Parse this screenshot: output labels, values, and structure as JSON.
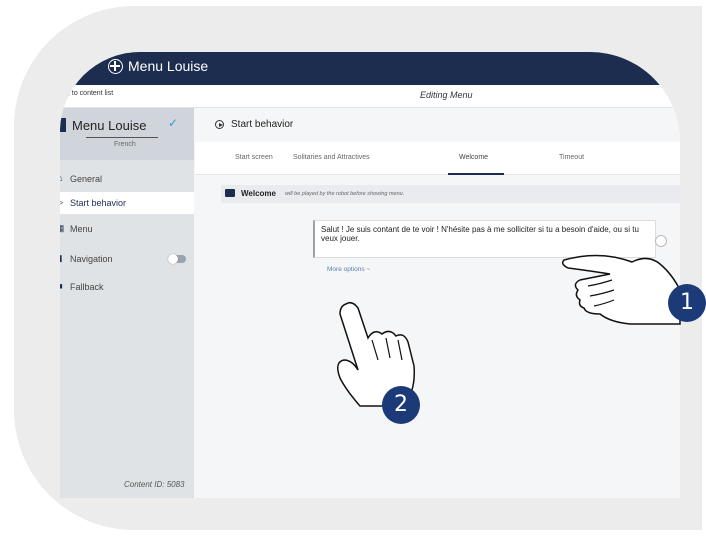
{
  "app": {
    "title": "Menu Louise"
  },
  "subbar": {
    "back_label": ", to content list",
    "editing_label": "Editing Menu"
  },
  "sidebar": {
    "menu_name": "Menu Louise",
    "language": "French",
    "items": [
      {
        "icon": "home-icon",
        "label": "General"
      },
      {
        "icon": "play-circle-icon",
        "label": "Start behavior"
      },
      {
        "icon": "grid-icon",
        "label": "Menu"
      },
      {
        "icon": "navigation-icon",
        "label": "Navigation"
      },
      {
        "icon": "fallback-icon",
        "label": "Fallback"
      }
    ],
    "content_id": "Content ID: 5083"
  },
  "main": {
    "section_title": "Start behavior",
    "tabs": [
      {
        "label": "Start screen"
      },
      {
        "label": "Solitaries and Attractives"
      },
      {
        "label": "Welcome"
      },
      {
        "label": "Timeout"
      }
    ],
    "welcome": {
      "title": "Welcome",
      "description": "will be played by the robot before showing menu."
    },
    "message": "Salut ! Je suis contant de te voir ! N'hésite pas à me solliciter si tu a besoin d'aide, ou si tu veux jouer.",
    "more_options": "More options ~"
  },
  "annotations": {
    "badge_1": "1",
    "badge_2": "2"
  },
  "colors": {
    "navy": "#1c2d4f",
    "badge": "#1c3a78",
    "accent": "#2d9cdb"
  }
}
